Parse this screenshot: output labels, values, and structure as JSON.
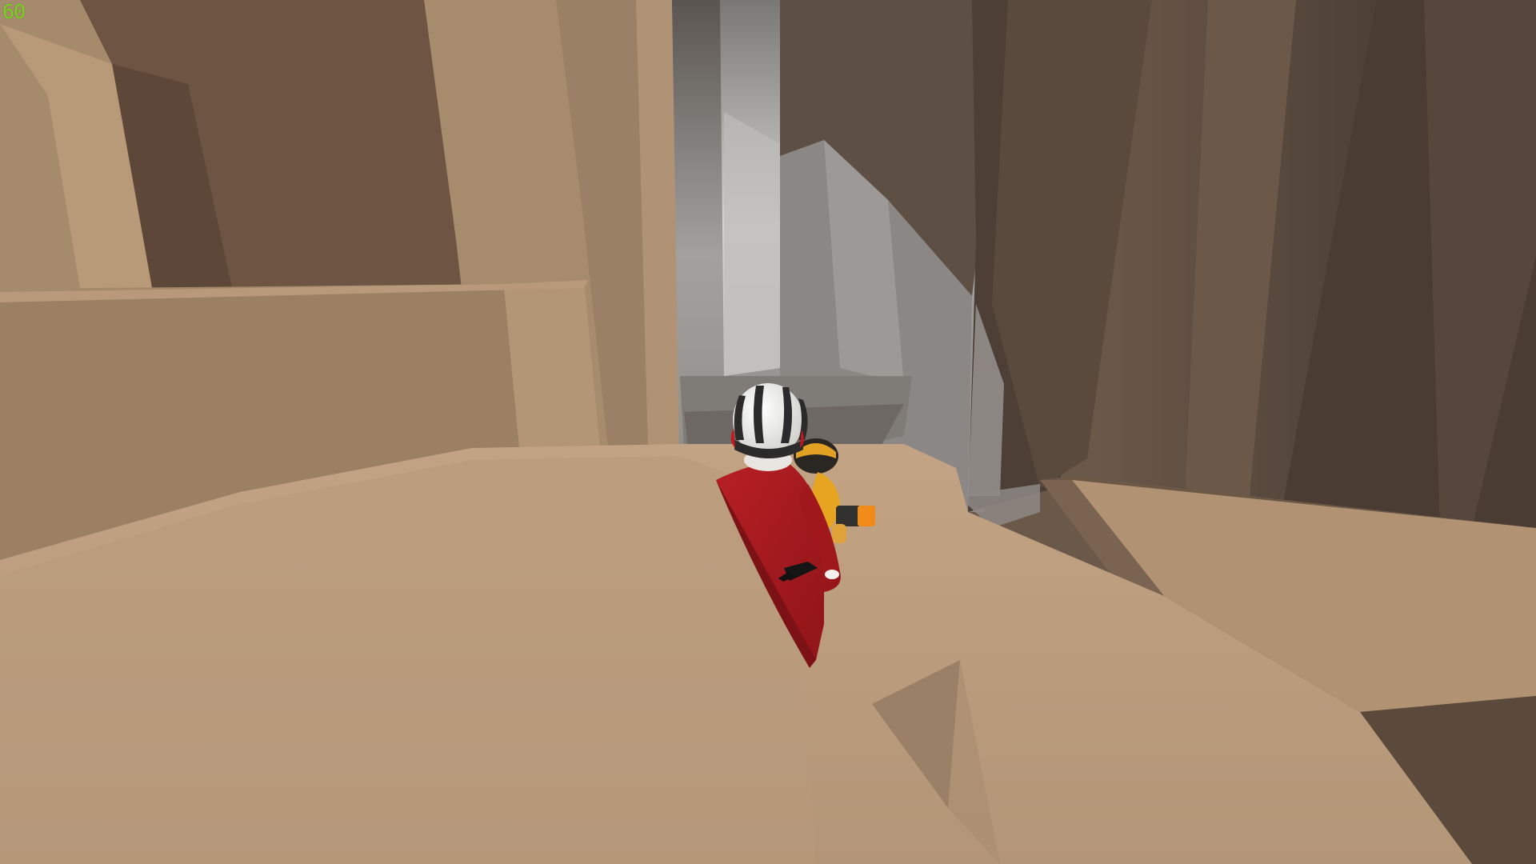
{
  "hud": {
    "fps": "60"
  },
  "palette": {
    "sand_light": "#bfa07f",
    "sand_mid": "#b29576",
    "rock_dark": "#5f4e40",
    "fog_grey": "#9c9a98",
    "outfit_red": "#a6181e",
    "helmet_white": "#f1f1ee",
    "companion_yellow": "#e7a421",
    "fps_green": "#78d21e"
  },
  "scene": {
    "environment": "sandstone-canyon",
    "player": {
      "outfit": "red-onesie",
      "headgear": "white-striped-helmet"
    },
    "companion": {
      "outfit": "yellow-onesie",
      "headgear": "black-helmet",
      "held_item": "orange-flashlight"
    }
  }
}
